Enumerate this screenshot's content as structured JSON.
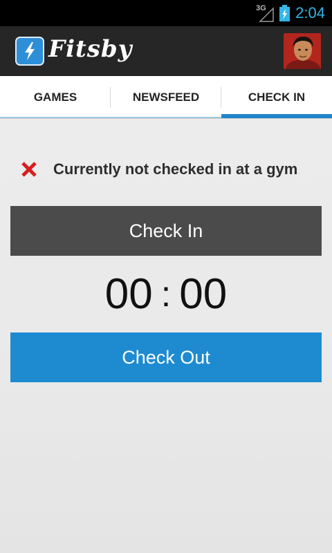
{
  "status_bar": {
    "network": "3G",
    "time": "2:04",
    "icons": [
      "signal-icon",
      "battery-charging-icon"
    ]
  },
  "action_bar": {
    "app_title": "Fitsby",
    "logo_icon": "lightning-bolt-icon",
    "avatar": "user-avatar"
  },
  "tabs": [
    {
      "label": "GAMES",
      "active": false
    },
    {
      "label": "NEWSFEED",
      "active": false
    },
    {
      "label": "CHECK IN",
      "active": true
    }
  ],
  "checkin": {
    "status_icon": "x-icon",
    "status_text": "Currently not checked in at a gym",
    "check_in_label": "Check In",
    "timer": {
      "minutes": "00",
      "separator": ":",
      "seconds": "00"
    },
    "check_out_label": "Check Out"
  },
  "colors": {
    "accent": "#33b5e5",
    "tab_indicator": "#2186c9",
    "check_in_button": "#4b4b4b",
    "check_out_button": "#1e8bd0",
    "error_red": "#d81e1e"
  }
}
